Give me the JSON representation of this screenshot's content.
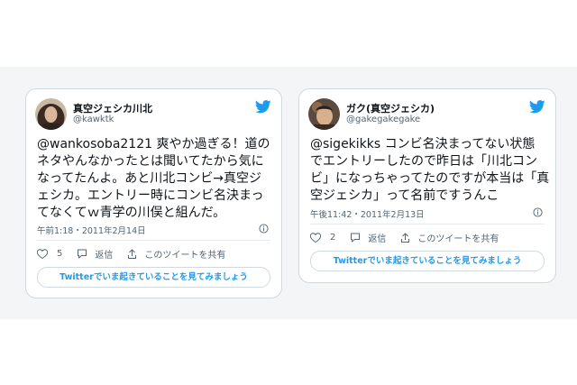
{
  "tweets": [
    {
      "display_name": "真空ジェシカ川北",
      "handle": "@kawktk",
      "lines": [
        "@wankosoba2121 爽やか過ぎる！道の",
        "ネタやんなかったとは聞いてたから気に",
        "なってたんよ。あと川北コンビ→真空ジ",
        "ェシカ。エントリー時にコンビ名決まっ",
        "てなくてｗ青学の川俣と組んだ。"
      ],
      "timestamp": "午前1:18・2011年2月14日",
      "like_count": "5",
      "reply_label": "返信",
      "share_label": "このツイートを共有",
      "cta": "Twitterでいま起きていることを見てみましょう"
    },
    {
      "display_name": "ガク(真空ジェシカ)",
      "handle": "@gakegakegake",
      "lines": [
        "@sigekikks コンビ名決まってない状態",
        "でエントリーしたので昨日は「川北コン",
        "ビ」になっちゃってたのですが本当は「真",
        "空ジェシカ」って名前ですうんこ"
      ],
      "timestamp": "午後11:42・2011年2月13日",
      "like_count": "2",
      "reply_label": "返信",
      "share_label": "このツイートを共有",
      "cta": "Twitterでいま起きていることを見てみましょう"
    }
  ],
  "colors": {
    "twitter_blue": "#1d9bf0",
    "heart_red": "#f91880",
    "muted": "#536471"
  }
}
